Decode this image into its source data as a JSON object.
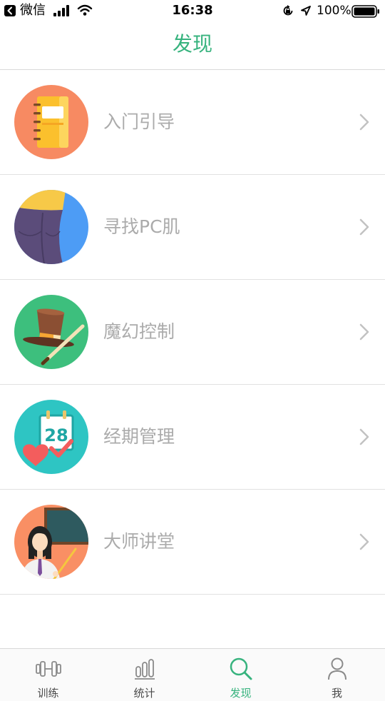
{
  "status_bar": {
    "back_app": "微信",
    "time": "16:38",
    "battery_percent": "100%",
    "icons": [
      "back-icon",
      "signal-icon",
      "wifi-icon",
      "rotation-lock-icon",
      "location-icon",
      "battery-icon"
    ]
  },
  "header": {
    "title": "发现"
  },
  "items": [
    {
      "label": "入门引导",
      "icon": "notebook-icon",
      "color": "#f78a62"
    },
    {
      "label": "寻找PC肌",
      "icon": "pc-muscle-icon",
      "color": "#4d9cf5"
    },
    {
      "label": "魔幻控制",
      "icon": "magic-hat-icon",
      "color": "#3dbf7d"
    },
    {
      "label": "经期管理",
      "icon": "calendar-heart-icon",
      "color": "#2ec5c3",
      "calendar_day": "28"
    },
    {
      "label": "大师讲堂",
      "icon": "teacher-icon",
      "color": "#f98f64"
    }
  ],
  "tabs": [
    {
      "label": "训练",
      "icon": "dumbbell-icon",
      "active": false
    },
    {
      "label": "统计",
      "icon": "bar-chart-icon",
      "active": false
    },
    {
      "label": "发现",
      "icon": "search-icon",
      "active": true
    },
    {
      "label": "我",
      "icon": "person-icon",
      "active": false
    }
  ],
  "colors": {
    "accent": "#37b37e",
    "label_text": "#ababab",
    "tab_inactive": "#4a4a4a",
    "icon_inactive": "#8a8a8a"
  }
}
